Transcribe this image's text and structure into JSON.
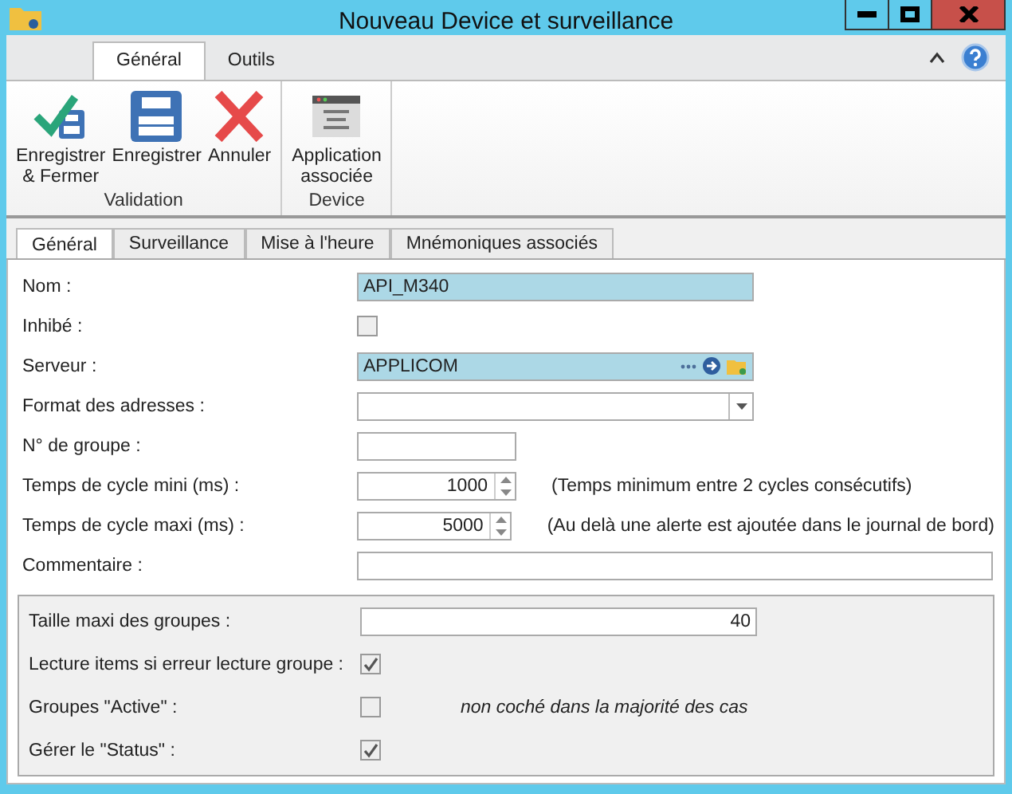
{
  "window": {
    "title": "Nouveau Device et surveillance"
  },
  "ribbon_tabs": [
    {
      "label": "Général",
      "selected": true
    },
    {
      "label": "Outils",
      "selected": false
    }
  ],
  "ribbon_groups": [
    {
      "label": "Validation",
      "buttons": [
        {
          "kind": "save-close",
          "label": "Enregistrer\n& Fermer"
        },
        {
          "kind": "save",
          "label": "Enregistrer"
        },
        {
          "kind": "cancel",
          "label": "Annuler"
        }
      ]
    },
    {
      "label": "Device",
      "buttons": [
        {
          "kind": "app",
          "label": "Application\nassociée"
        }
      ]
    }
  ],
  "form_tabs": [
    {
      "label": "Général",
      "selected": true
    },
    {
      "label": "Surveillance",
      "selected": false
    },
    {
      "label": "Mise à l'heure",
      "selected": false
    },
    {
      "label": "Mnémoniques associés",
      "selected": false
    }
  ],
  "fields": [
    {
      "kind": "text",
      "label": "Nom :",
      "value": "API_M340",
      "highlighted": true
    },
    {
      "kind": "checkbox",
      "label": "Inhibé :",
      "checked": false
    },
    {
      "kind": "lookup",
      "label": "Serveur :",
      "value": "APPLICOM",
      "highlighted": true
    },
    {
      "kind": "select",
      "label": "Format des adresses :"
    },
    {
      "kind": "short",
      "label": "N° de groupe :"
    },
    {
      "kind": "spin",
      "label": "Temps de cycle mini (ms) :",
      "value": "1000",
      "note": "(Temps minimum entre 2 cycles consécutifs)"
    },
    {
      "kind": "spin",
      "label": "Temps de cycle maxi (ms) :",
      "value": "5000",
      "note": "(Au delà une alerte est ajoutée dans le journal de bord)"
    },
    {
      "kind": "wide",
      "label": "Commentaire :"
    }
  ],
  "group_fields": [
    {
      "kind": "number",
      "label": "Taille maxi des groupes :",
      "value": "40"
    },
    {
      "kind": "checkbox",
      "label": "Lecture items si erreur lecture groupe :",
      "checked": true
    },
    {
      "kind": "checkbox",
      "label": "Groupes \"Active\" :",
      "checked": false,
      "note": "non coché dans la majorité des cas"
    },
    {
      "kind": "checkbox",
      "label": "Gérer le \"Status\" :",
      "checked": true
    }
  ]
}
